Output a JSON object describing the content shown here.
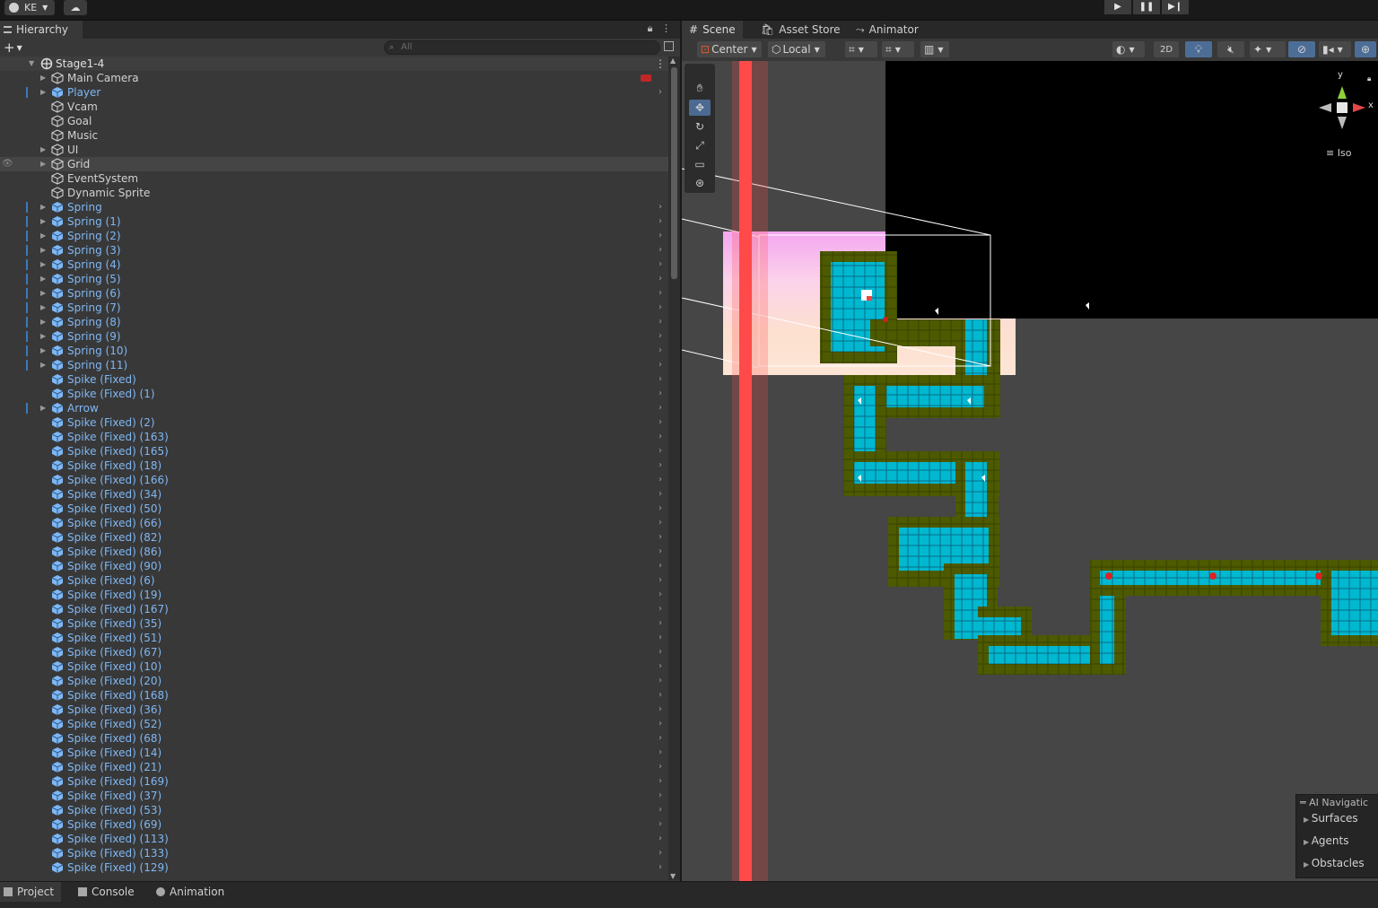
{
  "toolbar": {
    "account": "KE"
  },
  "hierarchy": {
    "tab_label": "Hierarchy",
    "search_placeholder": "All",
    "scene_name": "Stage1-4",
    "items": [
      {
        "label": "Main Camera",
        "color": "white",
        "expandable": true,
        "prefab": false,
        "mark": false,
        "chev": false
      },
      {
        "label": "Player",
        "color": "blue",
        "expandable": true,
        "prefab": true,
        "mark": true,
        "chev": true
      },
      {
        "label": "Vcam",
        "color": "white",
        "expandable": false,
        "prefab": false,
        "mark": false,
        "chev": false
      },
      {
        "label": "Goal",
        "color": "white",
        "expandable": false,
        "prefab": false,
        "mark": false,
        "chev": false
      },
      {
        "label": "Music",
        "color": "white",
        "expandable": false,
        "prefab": false,
        "mark": false,
        "chev": false
      },
      {
        "label": "UI",
        "color": "white",
        "expandable": true,
        "prefab": false,
        "mark": false,
        "chev": false
      },
      {
        "label": "Grid",
        "color": "white",
        "expandable": true,
        "prefab": false,
        "mark": false,
        "chev": false,
        "selected": true
      },
      {
        "label": "EventSystem",
        "color": "white",
        "expandable": false,
        "prefab": false,
        "mark": false,
        "chev": false
      },
      {
        "label": "Dynamic Sprite",
        "color": "white",
        "expandable": false,
        "prefab": false,
        "mark": false,
        "chev": false
      },
      {
        "label": "Spring",
        "color": "blue",
        "expandable": true,
        "prefab": true,
        "mark": true,
        "chev": true
      },
      {
        "label": "Spring (1)",
        "color": "blue",
        "expandable": true,
        "prefab": true,
        "mark": true,
        "chev": true
      },
      {
        "label": "Spring (2)",
        "color": "blue",
        "expandable": true,
        "prefab": true,
        "mark": true,
        "chev": true
      },
      {
        "label": "Spring (3)",
        "color": "blue",
        "expandable": true,
        "prefab": true,
        "mark": true,
        "chev": true
      },
      {
        "label": "Spring (4)",
        "color": "blue",
        "expandable": true,
        "prefab": true,
        "mark": true,
        "chev": true
      },
      {
        "label": "Spring (5)",
        "color": "blue",
        "expandable": true,
        "prefab": true,
        "mark": true,
        "chev": true
      },
      {
        "label": "Spring (6)",
        "color": "blue",
        "expandable": true,
        "prefab": true,
        "mark": true,
        "chev": true
      },
      {
        "label": "Spring (7)",
        "color": "blue",
        "expandable": true,
        "prefab": true,
        "mark": true,
        "chev": true
      },
      {
        "label": "Spring (8)",
        "color": "blue",
        "expandable": true,
        "prefab": true,
        "mark": true,
        "chev": true
      },
      {
        "label": "Spring (9)",
        "color": "blue",
        "expandable": true,
        "prefab": true,
        "mark": true,
        "chev": true
      },
      {
        "label": "Spring (10)",
        "color": "blue",
        "expandable": true,
        "prefab": true,
        "mark": true,
        "chev": true
      },
      {
        "label": "Spring (11)",
        "color": "blue",
        "expandable": true,
        "prefab": true,
        "mark": true,
        "chev": true
      },
      {
        "label": "Spike (Fixed)",
        "color": "blue",
        "expandable": false,
        "prefab": true,
        "mark": false,
        "chev": true
      },
      {
        "label": "Spike (Fixed) (1)",
        "color": "blue",
        "expandable": false,
        "prefab": true,
        "mark": false,
        "chev": true
      },
      {
        "label": "Arrow",
        "color": "blue",
        "expandable": true,
        "prefab": true,
        "mark": true,
        "chev": true
      },
      {
        "label": "Spike (Fixed) (2)",
        "color": "blue",
        "expandable": false,
        "prefab": true,
        "mark": false,
        "chev": true
      },
      {
        "label": "Spike (Fixed) (163)",
        "color": "blue",
        "expandable": false,
        "prefab": true,
        "mark": false,
        "chev": true
      },
      {
        "label": "Spike (Fixed) (165)",
        "color": "blue",
        "expandable": false,
        "prefab": true,
        "mark": false,
        "chev": true
      },
      {
        "label": "Spike (Fixed) (18)",
        "color": "blue",
        "expandable": false,
        "prefab": true,
        "mark": false,
        "chev": true
      },
      {
        "label": "Spike (Fixed) (166)",
        "color": "blue",
        "expandable": false,
        "prefab": true,
        "mark": false,
        "chev": true
      },
      {
        "label": "Spike (Fixed) (34)",
        "color": "blue",
        "expandable": false,
        "prefab": true,
        "mark": false,
        "chev": true
      },
      {
        "label": "Spike (Fixed) (50)",
        "color": "blue",
        "expandable": false,
        "prefab": true,
        "mark": false,
        "chev": true
      },
      {
        "label": "Spike (Fixed) (66)",
        "color": "blue",
        "expandable": false,
        "prefab": true,
        "mark": false,
        "chev": true
      },
      {
        "label": "Spike (Fixed) (82)",
        "color": "blue",
        "expandable": false,
        "prefab": true,
        "mark": false,
        "chev": true
      },
      {
        "label": "Spike (Fixed) (86)",
        "color": "blue",
        "expandable": false,
        "prefab": true,
        "mark": false,
        "chev": true
      },
      {
        "label": "Spike (Fixed) (90)",
        "color": "blue",
        "expandable": false,
        "prefab": true,
        "mark": false,
        "chev": true
      },
      {
        "label": "Spike (Fixed) (6)",
        "color": "blue",
        "expandable": false,
        "prefab": true,
        "mark": false,
        "chev": true
      },
      {
        "label": "Spike (Fixed) (19)",
        "color": "blue",
        "expandable": false,
        "prefab": true,
        "mark": false,
        "chev": true
      },
      {
        "label": "Spike (Fixed) (167)",
        "color": "blue",
        "expandable": false,
        "prefab": true,
        "mark": false,
        "chev": true
      },
      {
        "label": "Spike (Fixed) (35)",
        "color": "blue",
        "expandable": false,
        "prefab": true,
        "mark": false,
        "chev": true
      },
      {
        "label": "Spike (Fixed) (51)",
        "color": "blue",
        "expandable": false,
        "prefab": true,
        "mark": false,
        "chev": true
      },
      {
        "label": "Spike (Fixed) (67)",
        "color": "blue",
        "expandable": false,
        "prefab": true,
        "mark": false,
        "chev": true
      },
      {
        "label": "Spike (Fixed) (10)",
        "color": "blue",
        "expandable": false,
        "prefab": true,
        "mark": false,
        "chev": true
      },
      {
        "label": "Spike (Fixed) (20)",
        "color": "blue",
        "expandable": false,
        "prefab": true,
        "mark": false,
        "chev": true
      },
      {
        "label": "Spike (Fixed) (168)",
        "color": "blue",
        "expandable": false,
        "prefab": true,
        "mark": false,
        "chev": true
      },
      {
        "label": "Spike (Fixed) (36)",
        "color": "blue",
        "expandable": false,
        "prefab": true,
        "mark": false,
        "chev": true
      },
      {
        "label": "Spike (Fixed) (52)",
        "color": "blue",
        "expandable": false,
        "prefab": true,
        "mark": false,
        "chev": true
      },
      {
        "label": "Spike (Fixed) (68)",
        "color": "blue",
        "expandable": false,
        "prefab": true,
        "mark": false,
        "chev": true
      },
      {
        "label": "Spike (Fixed) (14)",
        "color": "blue",
        "expandable": false,
        "prefab": true,
        "mark": false,
        "chev": true
      },
      {
        "label": "Spike (Fixed) (21)",
        "color": "blue",
        "expandable": false,
        "prefab": true,
        "mark": false,
        "chev": true
      },
      {
        "label": "Spike (Fixed) (169)",
        "color": "blue",
        "expandable": false,
        "prefab": true,
        "mark": false,
        "chev": true
      },
      {
        "label": "Spike (Fixed) (37)",
        "color": "blue",
        "expandable": false,
        "prefab": true,
        "mark": false,
        "chev": true
      },
      {
        "label": "Spike (Fixed) (53)",
        "color": "blue",
        "expandable": false,
        "prefab": true,
        "mark": false,
        "chev": true
      },
      {
        "label": "Spike (Fixed) (69)",
        "color": "blue",
        "expandable": false,
        "prefab": true,
        "mark": false,
        "chev": true
      },
      {
        "label": "Spike (Fixed) (113)",
        "color": "blue",
        "expandable": false,
        "prefab": true,
        "mark": false,
        "chev": true
      },
      {
        "label": "Spike (Fixed) (133)",
        "color": "blue",
        "expandable": false,
        "prefab": true,
        "mark": false,
        "chev": true
      },
      {
        "label": "Spike (Fixed) (129)",
        "color": "blue",
        "expandable": false,
        "prefab": true,
        "mark": false,
        "chev": true
      }
    ]
  },
  "scene": {
    "tabs": [
      "Scene",
      "Asset Store",
      "Animator"
    ],
    "pivot_mode": "Center",
    "pivot_rotation": "Local",
    "mode_2d": "2D",
    "gizmo_projection": "Iso",
    "gizmo_axes": {
      "y": "y",
      "x": "x"
    },
    "ai_navigation": {
      "title": "AI Navigatic",
      "items": [
        "Surfaces",
        "Agents",
        "Obstacles"
      ]
    }
  },
  "bottom_tabs": [
    "Project",
    "Console",
    "Animation"
  ],
  "colors": {
    "prefab_label": "#7fb7f4",
    "tile_cyan": "#00b8d0",
    "tile_border": "#4d5a00",
    "red_line": "#ff4a4a"
  }
}
